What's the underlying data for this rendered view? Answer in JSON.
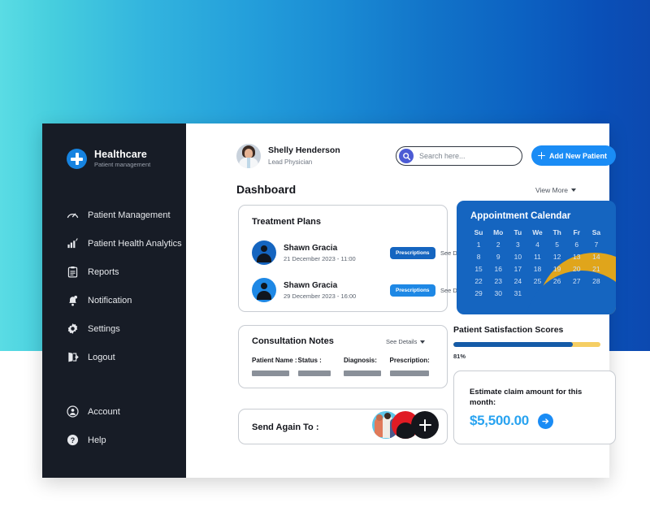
{
  "theme": {
    "gradient_from": "#5ADCE4",
    "gradient_to": "#0C49B0",
    "sidebar_bg": "#171C26",
    "accent_blue": "#1A8CF5",
    "calendar_blue": "#1565C0",
    "gold": "#E0A51B",
    "amount_blue": "#29A3F0"
  },
  "sidebar": {
    "brand": {
      "name": "Healthcare",
      "subtitle": "Patient management",
      "logo_icon": "medical-cross-icon"
    },
    "items": [
      {
        "label": "Patient Management",
        "icon": "gauge-icon"
      },
      {
        "label": "Patient Health Analytics",
        "icon": "bar-chart-icon"
      },
      {
        "label": "Reports",
        "icon": "clipboard-icon"
      },
      {
        "label": "Notification",
        "icon": "bell-icon"
      },
      {
        "label": "Settings",
        "icon": "gear-icon"
      },
      {
        "label": "Logout",
        "icon": "logout-icon"
      }
    ],
    "bottom_items": [
      {
        "label": "Account",
        "icon": "user-circle-icon"
      },
      {
        "label": "Help",
        "icon": "question-circle-icon"
      }
    ]
  },
  "header": {
    "profile": {
      "name": "Shelly Henderson",
      "role": "Lead Physician",
      "avatar_icon": "doctor-avatar"
    },
    "search": {
      "value": "",
      "placeholder": "Search here...",
      "icon": "search-icon"
    },
    "add_patient_button": {
      "label": "Add New Patient",
      "icon": "plus-icon"
    },
    "page_title": "Dashboard",
    "view_more": {
      "label": "View More",
      "icon": "chevron-down-icon"
    }
  },
  "treatment_plans": {
    "title": "Treatment Plans",
    "rows": [
      {
        "patient": "Shawn Gracia",
        "datetime": "21 December 2023 - 11:00",
        "button": "Prescriptions",
        "button_color": "#1565C0",
        "avatar_bg": "#1565C0",
        "details": "See Details"
      },
      {
        "patient": "Shawn Gracia",
        "datetime": "29 December 2023 - 16:00",
        "button": "Prescriptions",
        "button_color": "#1E88E5",
        "avatar_bg": "#1E88E5",
        "details": "See Details"
      }
    ]
  },
  "consultation_notes": {
    "title": "Consultation Notes",
    "details": "See Details",
    "columns": [
      "Patient Name :",
      "Status :",
      "Diagnosis:",
      "Prescription:"
    ]
  },
  "send_again": {
    "title": "Send Again To :",
    "avatars": [
      "group-photo-avatar",
      "red-avatar",
      "add-recipient-button"
    ],
    "add_icon": "plus-icon"
  },
  "calendar": {
    "title": "Appointment Calendar",
    "day_headers": [
      "Su",
      "Mo",
      "Tu",
      "We",
      "Th",
      "Fr",
      "Sa"
    ],
    "leading_blanks": 0,
    "days": [
      1,
      2,
      3,
      4,
      5,
      6,
      7,
      8,
      9,
      10,
      11,
      12,
      13,
      14,
      15,
      16,
      17,
      18,
      19,
      20,
      21,
      22,
      23,
      24,
      25,
      26,
      27,
      28,
      29,
      30,
      31
    ],
    "decoration": "gold-crescent-swoosh"
  },
  "satisfaction": {
    "title": "Patient Satisfaction Scores",
    "percent_label": "81%",
    "percent_value": 81
  },
  "estimate": {
    "label": "Estimate claim amount for this month:",
    "amount": "$5,500.00",
    "arrow_icon": "arrow-right-icon"
  }
}
